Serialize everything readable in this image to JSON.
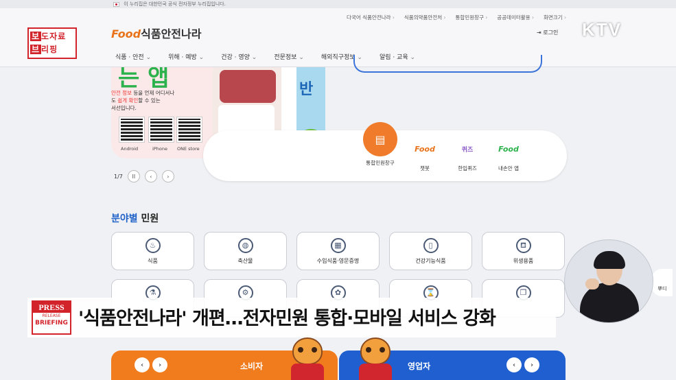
{
  "gov_strip": {
    "text": "이 누리집은 대한민국 공식 전자정부 누리집입니다."
  },
  "header": {
    "util_links": [
      "다국어 식품안전나라",
      "식품의약품안전처",
      "통합민원창구",
      "공공데이터활용",
      "화면크기"
    ],
    "logo_prefix": "Food",
    "logo_text": "식품안전나라",
    "login": "로그인",
    "gnb": [
      "식품 · 안전",
      "위해 · 예방",
      "건강 · 영양",
      "전문정보",
      "해외직구정보",
      "알림 · 교육"
    ]
  },
  "broadcast": {
    "channel": "KTV",
    "briefing_badge": {
      "row1a": "보",
      "row1b": "도자료",
      "row2a": "브",
      "row2b": "리핑"
    }
  },
  "banner": {
    "big_text": "는 앱",
    "desc_line1_red": "안전 정보",
    "desc_line1": " 등을 언제 어디서나",
    "desc_line2_a": "도 ",
    "desc_line2_red": "쉽게 확인",
    "desc_line2_b": "할 수 있는",
    "desc_line3": "서선입니다.",
    "qr_labels": [
      "Android",
      "iPhone",
      "ONE store"
    ],
    "side_text": "반"
  },
  "pager": {
    "current": "1/7",
    "pause_icon": "II",
    "prev_icon": "‹",
    "next_icon": "›"
  },
  "quick_menu": [
    {
      "label": "통합민원창구",
      "icon": "▤",
      "color": "#f07b2a"
    },
    {
      "label": "챗봇",
      "icon": "Food",
      "color": "#e8731b"
    },
    {
      "label": "한입퀴즈",
      "icon": "퀴즈",
      "color": "#8a56c8"
    },
    {
      "label": "내손안 앱",
      "icon": "Food",
      "color": "#2bb24c"
    }
  ],
  "section": {
    "title_highlight": "분야별",
    "title_rest": " 민원"
  },
  "categories_row1": [
    {
      "label": "식품",
      "icon": "♨"
    },
    {
      "label": "축산물",
      "icon": "◍"
    },
    {
      "label": "수입식품·영문증명",
      "icon": "▦"
    },
    {
      "label": "건강기능식품",
      "icon": "▯"
    },
    {
      "label": "위생용품",
      "icon": "⛾"
    }
  ],
  "categories_row2_icons": [
    "⚗",
    "⚙",
    "✿",
    "⌛",
    "❐"
  ],
  "bottom_cards": {
    "consumer": "소비자",
    "business": "영업자",
    "prev": "‹",
    "next": "›"
  },
  "press": {
    "logo_line1": "PRESS",
    "logo_line2": "RELEASE",
    "logo_line3": "BRIEFING",
    "headline": "'식품안전나라' 개편…전자민원 통합·모바일 서비스 강화"
  },
  "side_peek_label": "뿌디"
}
